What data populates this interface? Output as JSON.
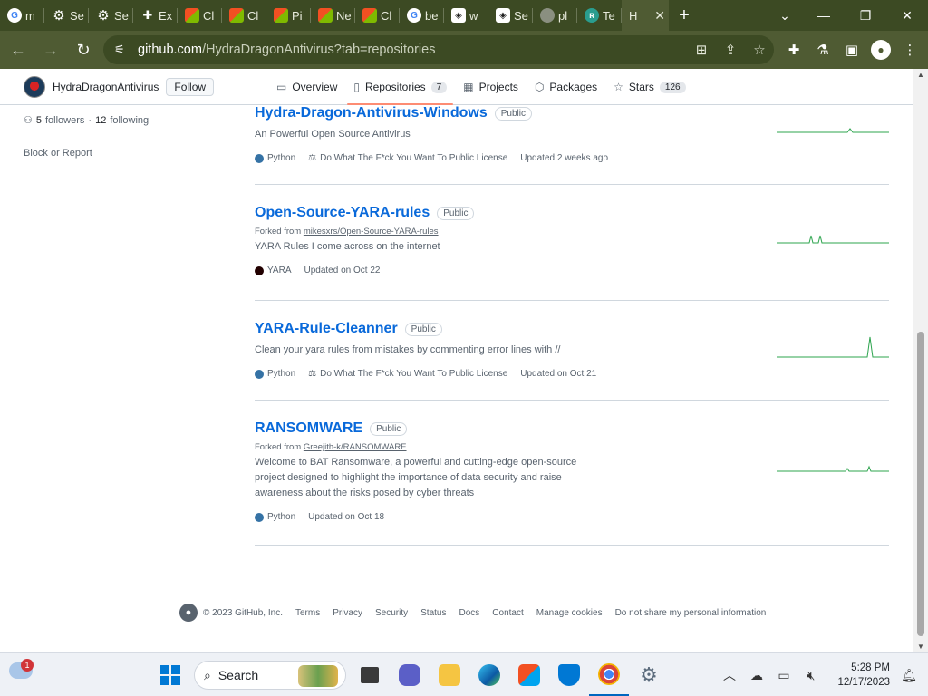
{
  "browser": {
    "tabs": [
      {
        "label": "m",
        "icon": "google-icon"
      },
      {
        "label": "Se",
        "icon": "gear-icon"
      },
      {
        "label": "Se",
        "icon": "gear-icon"
      },
      {
        "label": "Ex",
        "icon": "puzzle-icon"
      },
      {
        "label": "Cl",
        "icon": "rainbow-icon"
      },
      {
        "label": "Cl",
        "icon": "rainbow-icon"
      },
      {
        "label": "Pi",
        "icon": "rainbow-icon"
      },
      {
        "label": "Ne",
        "icon": "rainbow-icon"
      },
      {
        "label": "Cl",
        "icon": "rainbow-icon"
      },
      {
        "label": "be",
        "icon": "google-icon"
      },
      {
        "label": "w",
        "icon": "shield-icon"
      },
      {
        "label": "Se",
        "icon": "shield-icon"
      },
      {
        "label": "pl",
        "icon": "globe-icon"
      },
      {
        "label": "Te",
        "icon": "te-icon"
      },
      {
        "label": "H",
        "icon": "github-icon"
      }
    ],
    "url_host": "github.com",
    "url_path": "/HydraDragonAntivirus?tab=repositories"
  },
  "profile": {
    "username": "HydraDragonAntivirus",
    "follow_label": "Follow",
    "followers_count": "5",
    "followers_label": "followers",
    "separator": "·",
    "following_count": "12",
    "following_label": "following",
    "block_label": "Block or Report"
  },
  "nav": {
    "overview": "Overview",
    "repositories": "Repositories",
    "repositories_count": "7",
    "projects": "Projects",
    "packages": "Packages",
    "stars": "Stars",
    "stars_count": "126"
  },
  "repos": [
    {
      "name": "Hydra-Dragon-Antivirus-Windows",
      "visibility": "Public",
      "forked_prefix": "",
      "forked_from": "",
      "description": "An Powerful Open Source Antivirus",
      "language": "Python",
      "language_color": "#3572A5",
      "license": "Do What The F*ck You Want To Public License",
      "updated": "Updated 2 weeks ago"
    },
    {
      "name": "Open-Source-YARA-rules",
      "visibility": "Public",
      "forked_prefix": "Forked from",
      "forked_from": "mikesxrs/Open-Source-YARA-rules",
      "description": "YARA Rules I come across on the internet",
      "language": "YARA",
      "language_color": "#220000",
      "license": "",
      "updated": "Updated on Oct 22"
    },
    {
      "name": "YARA-Rule-Cleanner",
      "visibility": "Public",
      "forked_prefix": "",
      "forked_from": "",
      "description": "Clean your yara rules from mistakes by commenting error lines with //",
      "language": "Python",
      "language_color": "#3572A5",
      "license": "Do What The F*ck You Want To Public License",
      "updated": "Updated on Oct 21"
    },
    {
      "name": "RANSOMWARE",
      "visibility": "Public",
      "forked_prefix": "Forked from",
      "forked_from": "Greejith-k/RANSOMWARE",
      "description": "Welcome to BAT Ransomware, a powerful and cutting-edge open-source project designed to highlight the importance of data security and raise awareness about the risks posed by cyber threats",
      "language": "Python",
      "language_color": "#3572A5",
      "license": "",
      "updated": "Updated on Oct 18"
    }
  ],
  "footer": {
    "copyright": "© 2023 GitHub, Inc.",
    "links": [
      "Terms",
      "Privacy",
      "Security",
      "Status",
      "Docs",
      "Contact",
      "Manage cookies",
      "Do not share my personal information"
    ]
  },
  "taskbar": {
    "notification_count": "1",
    "search_label": "Search",
    "time": "5:28 PM",
    "date": "12/17/2023"
  },
  "colors": {
    "browser_frame": "#3c4a23",
    "link_blue": "#0969da",
    "tab_underline": "#fd8c73",
    "spark_green": "#2da44e"
  }
}
